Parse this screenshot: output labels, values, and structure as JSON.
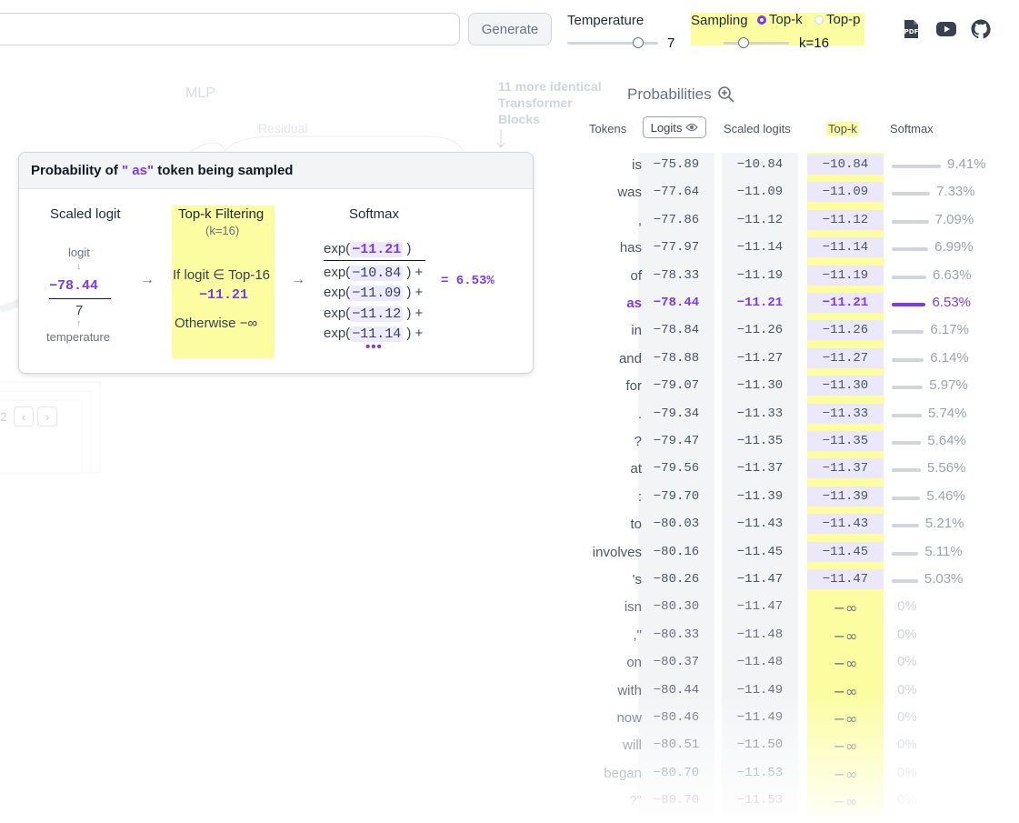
{
  "header": {
    "generate_label": "Generate",
    "temperature": {
      "label": "Temperature",
      "value": "7",
      "level": 0.78
    },
    "sampling": {
      "label": "Sampling",
      "options": [
        "Top-k",
        "Top-p"
      ],
      "selected": "Top-k",
      "value": "k=16",
      "level": 0.3
    },
    "icons": [
      "pdf-icon",
      "youtube-icon",
      "github-icon"
    ]
  },
  "background": {
    "mlp_label": "MLP",
    "residual_label": "Residual",
    "blocks_count": "11",
    "blocks_text": "more identical Transformer Blocks",
    "page_num": "2"
  },
  "popup": {
    "title_prefix": "Probability of",
    "token": "\" as\"",
    "title_suffix": "token being sampled",
    "scaled_logit": {
      "heading": "Scaled logit",
      "logit_label": "logit",
      "logit_value": "−78.44",
      "temperature_value": "7",
      "temperature_label": "temperature"
    },
    "topk": {
      "heading": "Top-k Filtering",
      "k_note": "(k=16)",
      "condition": "If logit ∈ Top-16",
      "value": "−11.21",
      "otherwise": "Otherwise −∞"
    },
    "softmax": {
      "heading": "Softmax",
      "numerator": "−11.21",
      "denominators": [
        "−10.84",
        "−11.09",
        "−11.12",
        "−11.14"
      ],
      "result": "= 6.53%"
    }
  },
  "probabilities": {
    "title": "Probabilities",
    "columns": {
      "tokens": "Tokens",
      "logits": "Logits",
      "scaled": "Scaled logits",
      "topk": "Top-k",
      "softmax": "Softmax"
    },
    "rows": [
      {
        "token": "is",
        "logit": "−75.89",
        "scaled": "−10.84",
        "topk": "−10.84",
        "prob": "9.41%",
        "p": 9.41
      },
      {
        "token": "was",
        "logit": "−77.64",
        "scaled": "−11.09",
        "topk": "−11.09",
        "prob": "7.33%",
        "p": 7.33
      },
      {
        "token": ",",
        "logit": "−77.86",
        "scaled": "−11.12",
        "topk": "−11.12",
        "prob": "7.09%",
        "p": 7.09
      },
      {
        "token": "has",
        "logit": "−77.97",
        "scaled": "−11.14",
        "topk": "−11.14",
        "prob": "6.99%",
        "p": 6.99
      },
      {
        "token": "of",
        "logit": "−78.33",
        "scaled": "−11.19",
        "topk": "−11.19",
        "prob": "6.63%",
        "p": 6.63
      },
      {
        "token": "as",
        "logit": "−78.44",
        "scaled": "−11.21",
        "topk": "−11.21",
        "prob": "6.53%",
        "p": 6.53,
        "selected": true
      },
      {
        "token": "in",
        "logit": "−78.84",
        "scaled": "−11.26",
        "topk": "−11.26",
        "prob": "6.17%",
        "p": 6.17
      },
      {
        "token": "and",
        "logit": "−78.88",
        "scaled": "−11.27",
        "topk": "−11.27",
        "prob": "6.14%",
        "p": 6.14
      },
      {
        "token": "for",
        "logit": "−79.07",
        "scaled": "−11.30",
        "topk": "−11.30",
        "prob": "5.97%",
        "p": 5.97
      },
      {
        "token": ".",
        "logit": "−79.34",
        "scaled": "−11.33",
        "topk": "−11.33",
        "prob": "5.74%",
        "p": 5.74
      },
      {
        "token": "?",
        "logit": "−79.47",
        "scaled": "−11.35",
        "topk": "−11.35",
        "prob": "5.64%",
        "p": 5.64
      },
      {
        "token": "at",
        "logit": "−79.56",
        "scaled": "−11.37",
        "topk": "−11.37",
        "prob": "5.56%",
        "p": 5.56
      },
      {
        "token": ":",
        "logit": "−79.70",
        "scaled": "−11.39",
        "topk": "−11.39",
        "prob": "5.46%",
        "p": 5.46
      },
      {
        "token": "to",
        "logit": "−80.03",
        "scaled": "−11.43",
        "topk": "−11.43",
        "prob": "5.21%",
        "p": 5.21
      },
      {
        "token": "involves",
        "logit": "−80.16",
        "scaled": "−11.45",
        "topk": "−11.45",
        "prob": "5.11%",
        "p": 5.11
      },
      {
        "token": "'s",
        "logit": "−80.26",
        "scaled": "−11.47",
        "topk": "−11.47",
        "prob": "5.03%",
        "p": 5.03
      },
      {
        "token": "isn",
        "logit": "−80.30",
        "scaled": "−11.47",
        "topk": "−∞",
        "prob": "0%",
        "p": 0
      },
      {
        "token": ",\"",
        "logit": "−80.33",
        "scaled": "−11.48",
        "topk": "−∞",
        "prob": "0%",
        "p": 0
      },
      {
        "token": "on",
        "logit": "−80.37",
        "scaled": "−11.48",
        "topk": "−∞",
        "prob": "0%",
        "p": 0
      },
      {
        "token": "with",
        "logit": "−80.44",
        "scaled": "−11.49",
        "topk": "−∞",
        "prob": "0%",
        "p": 0
      },
      {
        "token": "now",
        "logit": "−80.46",
        "scaled": "−11.49",
        "topk": "−∞",
        "prob": "0%",
        "p": 0
      },
      {
        "token": "will",
        "logit": "−80.51",
        "scaled": "−11.50",
        "topk": "−∞",
        "prob": "0%",
        "p": 0
      },
      {
        "token": "began",
        "logit": "−80.70",
        "scaled": "−11.53",
        "topk": "−∞",
        "prob": "0%",
        "p": 0
      },
      {
        "token": "?\"",
        "logit": "−80.70",
        "scaled": "−11.53",
        "topk": "−∞",
        "prob": "0%",
        "p": 0
      }
    ]
  },
  "colors": {
    "accent": "#7c3aed",
    "highlight": "#fbfda0",
    "pill": "#ebe8fb"
  }
}
